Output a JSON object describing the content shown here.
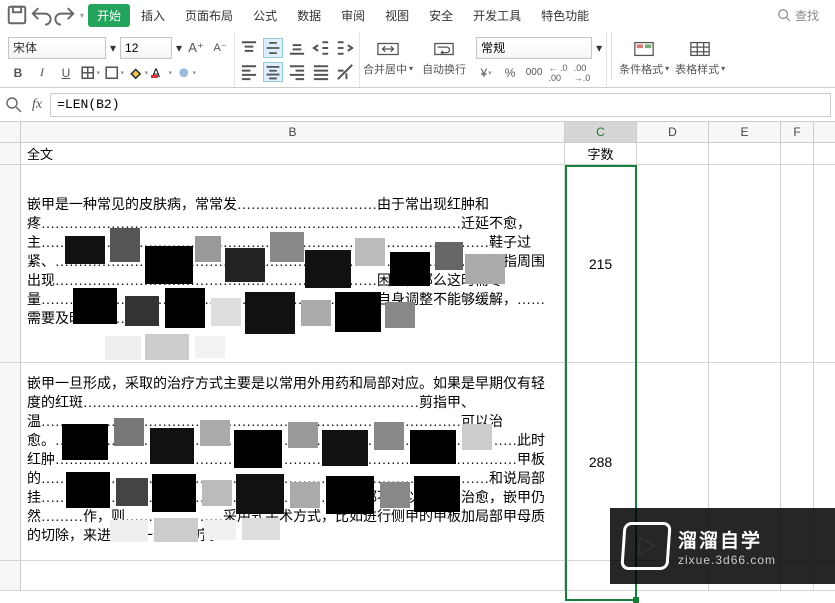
{
  "menubar": {
    "tabs": [
      "开始",
      "插入",
      "页面布局",
      "公式",
      "数据",
      "审阅",
      "视图",
      "安全",
      "开发工具",
      "特色功能"
    ],
    "active_tab": "开始",
    "search_label": "查找"
  },
  "ribbon": {
    "font_name": "宋体",
    "font_size": "12",
    "merge_label": "合并居中",
    "wrap_label": "自动换行",
    "number_format": "常规",
    "cond_fmt_label": "条件格式",
    "table_style_label": "表格样式"
  },
  "formula": {
    "value": "=LEN(B2)"
  },
  "columns": [
    "B",
    "C",
    "D",
    "E",
    "F"
  ],
  "selected_col": "C",
  "header_row": {
    "B": "全文",
    "C": "字数"
  },
  "rows": [
    {
      "B": "嵌甲是一种常见的皮肤病，常常发…………………………由于常出现红肿和疼………………………………………………………………………………迁延不愈，主……………………………………………………………………………………鞋子过紧、……………………………………………………………………………………指周围出现……………………………………………………………困难，那么这时需尽量…………………………………………………………通过自身调整不能够缓解，……需要及时到………",
      "C": "215"
    },
    {
      "B": "嵌甲一旦形成，采取的治疗方式主要是以常用外用药和局部对应。如果是早期仅有轻度的红斑………………………………………………………………剪指甲、温………………………………………………………………………………可以治愈。………………………………………………………………………………………此时红肿………………………………………………………………………………………甲板的……………………………………………………………………………………和说局部挂……………………………………………………………都不可以进一步治愈，嵌甲仍然………作，则…………………采用式手术方式，比如进行侧甲的甲板加局部甲母质的切除，来进行进一步的治疗。",
      "C": "288"
    }
  ],
  "watermark": {
    "line1": "溜溜自学",
    "line2": "zixue.3d66.com"
  }
}
